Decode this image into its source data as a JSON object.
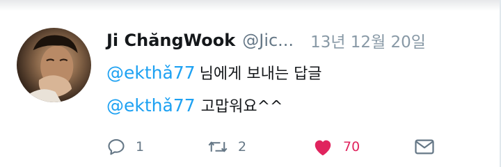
{
  "tweet": {
    "author_name": "Ji ChăngWook",
    "author_handle": "@Jic...",
    "date": "13년 12월 20일",
    "reply_to_mention": "@ekthǎ77",
    "reply_to_text": "님에게 보내는 답글",
    "body_mention": "@ekthǎ77",
    "body_text": "고맙워요^^"
  },
  "actions": {
    "reply_count": "1",
    "retweet_count": "2",
    "like_count": "70",
    "liked": true
  },
  "icons": {
    "reply": "reply-icon",
    "retweet": "retweet-icon",
    "like": "heart-icon",
    "message": "envelope-icon"
  },
  "colors": {
    "mention": "#1da1f2",
    "like": "#e0245e",
    "icon": "#657786"
  }
}
